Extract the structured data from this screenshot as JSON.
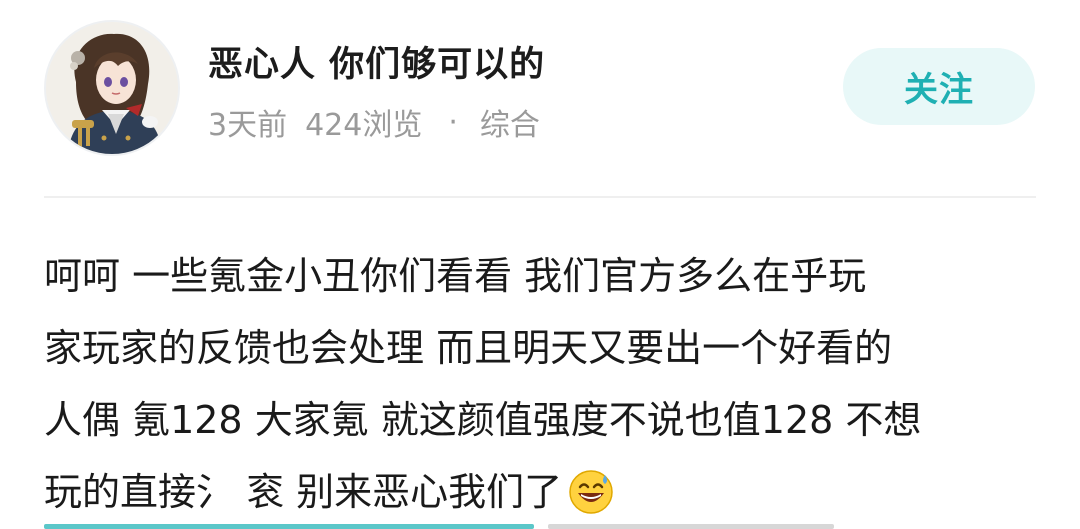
{
  "author": {
    "name": "恶心人 你们够可以的",
    "avatar_icon": "anime-character-avatar"
  },
  "meta": {
    "time": "3天前",
    "views": "424浏览",
    "separator": "·",
    "category": "综合"
  },
  "follow_button": {
    "label": "关注",
    "bg_color": "#e8f8f8",
    "text_color": "#1fb0b3"
  },
  "post": {
    "lines": [
      "呵呵 一些氪金小丑你们看看 我们官方多么在乎玩",
      "家玩家的反馈也会处理 而且明天又要出一个好看的",
      "人偶 氪128 大家氪 就这颜值强度不说也值128 不想",
      "玩的直接氵 衮  别来恶心我们了"
    ],
    "trailing_emoji": "grinning-sweat-emoji"
  }
}
